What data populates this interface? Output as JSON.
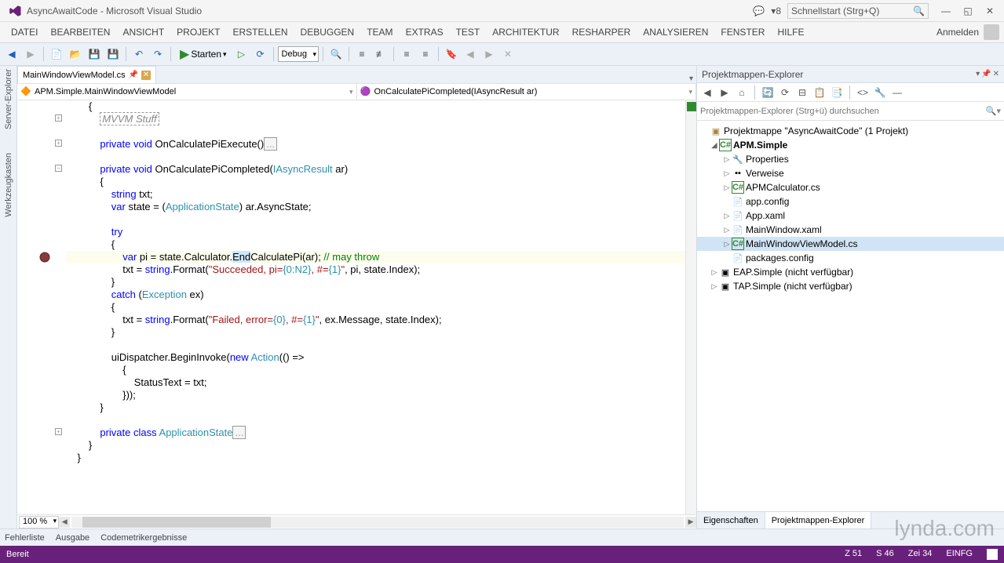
{
  "title": "AsyncAwaitCode - Microsoft Visual Studio",
  "flag_count": "8",
  "quick_launch_placeholder": "Schnellstart (Strg+Q)",
  "menu": [
    "DATEI",
    "BEARBEITEN",
    "ANSICHT",
    "PROJEKT",
    "ERSTELLEN",
    "DEBUGGEN",
    "TEAM",
    "EXTRAS",
    "TEST",
    "ARCHITEKTUR",
    "RESHARPER",
    "ANALYSIEREN",
    "FENSTER",
    "HILFE"
  ],
  "signin": "Anmelden",
  "start_label": "Starten",
  "config": "Debug",
  "left_rail": [
    "Server-Explorer",
    "Werkzeugkasten"
  ],
  "file_tab": "MainWindowViewModel.cs",
  "nav_left": "APM.Simple.MainWindowViewModel",
  "nav_right": "OnCalculatePiCompleted(IAsyncResult ar)",
  "zoom": "100 %",
  "solution_panel": {
    "title": "Projektmappen-Explorer",
    "search_placeholder": "Projektmappen-Explorer (Strg+ü) durchsuchen",
    "root": "Projektmappe \"AsyncAwaitCode\" (1 Projekt)",
    "project": "APM.Simple",
    "props": "Properties",
    "refs": "Verweise",
    "f1": "APMCalculator.cs",
    "f2": "app.config",
    "f3": "App.xaml",
    "f4": "MainWindow.xaml",
    "f5": "MainWindowViewModel.cs",
    "f6": "packages.config",
    "p2": "EAP.Simple (nicht verfügbar)",
    "p3": "TAP.Simple (nicht verfügbar)",
    "tab_props": "Eigenschaften",
    "tab_sln": "Projektmappen-Explorer"
  },
  "bottom_tabs": [
    "Fehlerliste",
    "Ausgabe",
    "Codemetrikergebnisse"
  ],
  "status": {
    "ready": "Bereit",
    "line": "Z 51",
    "col": "S 46",
    "ch": "Zei 34",
    "ins": "EINFG"
  },
  "watermark": "lynda.com",
  "code": {
    "mvvm": "MVVM Stuff",
    "private": "private",
    "void": "void",
    "var": "var",
    "string_kw": "string",
    "try": "try",
    "catch": "catch",
    "new": "new",
    "class": "class",
    "m1": "OnCalculatePiExecute()",
    "m2": "OnCalculatePiCompleted(",
    "iasync": "IAsyncResult",
    "ar": " ar)",
    "l_txt": " txt;",
    "l_state": " state = (",
    "appstate": "ApplicationState",
    "l_state2": ") ar.AsyncState;",
    "l_pi1": " pi = state.Calculator.",
    "end_sel": "End",
    "l_pi2": "CalculatePi(ar); ",
    "cmt1": "// may throw",
    "l_s1a": "txt = ",
    "l_s1b": ".Format(",
    "str1a": "\"Succeeded, pi=",
    "fmt1": "{0:N2}",
    "str1b": ", #=",
    "fmt2": "{1}",
    "str1c": "\"",
    "l_s1c": ", pi, state.Index);",
    "exception": "Exception",
    "ex": " ex)",
    "str2a": "\"Failed, error=",
    "fmt3": "{0}",
    "str2b": ", #=",
    "fmt4": "{1}",
    "str2c": "\"",
    "l_s2c": ", ex.Message, state.Index);",
    "l_disp": "uiDispatcher.BeginInvoke(",
    "action": "Action",
    "l_lambda": "(() =>",
    "l_status": "StatusText = txt;",
    "l_close": "}));",
    "collapsed": "..."
  }
}
